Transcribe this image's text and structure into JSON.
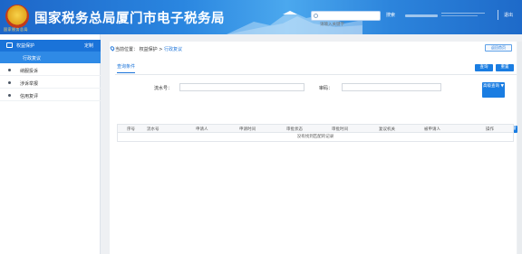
{
  "header": {
    "site_title": "国家税务总局厦门市电子税务局",
    "logo_text": "国家税务总局",
    "search_placeholder": "请输入关键字",
    "search_label": "搜索",
    "logout_label": "退出"
  },
  "sidebar": {
    "section_title": "权益保护",
    "customize_label": "定制",
    "active_item": "行政复议",
    "items": [
      {
        "label": "纳服投诉"
      },
      {
        "label": "涉诉举报"
      },
      {
        "label": "信用复评"
      }
    ]
  },
  "breadcrumb": {
    "prefix": "当前位置：",
    "root": "权益保护",
    "separator": " > ",
    "current": "行政复议"
  },
  "toolbar": {
    "return_label": "返回首页"
  },
  "query": {
    "tab_label": "查询条件",
    "query_button": "查询",
    "reset_button": "重置",
    "field1_label": "流水号：",
    "field1_value": "",
    "field2_label": "审码：",
    "field2_value": "",
    "advanced_label": "高级查询 ▼"
  },
  "actions": {
    "add_label": "+ 新增"
  },
  "table": {
    "columns": [
      "序号",
      "流水号",
      "申请人",
      "申请时间",
      "审批状态",
      "审批时间",
      "复议机关",
      "被申请人",
      "操作"
    ],
    "empty_text": "没有找到匹配的记录"
  }
}
